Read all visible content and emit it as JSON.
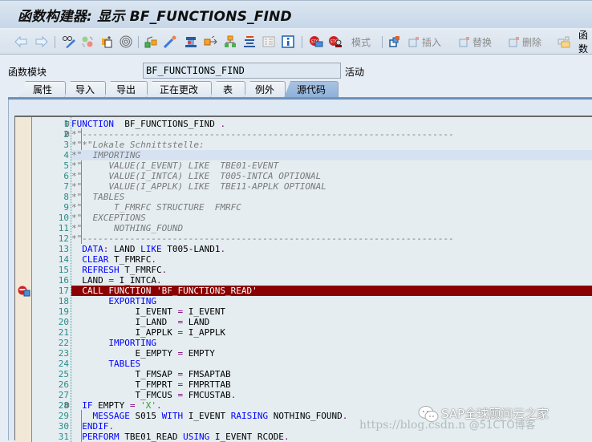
{
  "window": {
    "title": "函数构建器: 显示 BF_FUNCTIONS_FIND"
  },
  "toolbar": {
    "icons": [
      "back-arrow-icon",
      "forward-arrow-icon",
      "display-change-icon",
      "active-inactive-icon",
      "other-object-icon",
      "where-used-icon",
      "check-icon",
      "activate-icon",
      "test-icon",
      "pattern-icon",
      "object-list-icon",
      "pretty-printer-icon",
      "display-object-list-icon",
      "info-icon",
      "breakpoint-session-icon",
      "breakpoint-external-icon",
      "mode-icon",
      "insert-icon",
      "replace-icon",
      "delete-icon",
      "function-doc-icon"
    ],
    "mode_label": "模式",
    "insert_label": "插入",
    "replace_label": "替换",
    "delete_label": "删除",
    "function_doc_label": "函数"
  },
  "header": {
    "field_label": "函数模块",
    "field_value": "BF_FUNCTIONS_FIND",
    "status": "活动"
  },
  "tabs": [
    {
      "label": "属性",
      "active": false
    },
    {
      "label": "导入",
      "active": false
    },
    {
      "label": "导出",
      "active": false
    },
    {
      "label": "正在更改",
      "active": false
    },
    {
      "label": "表",
      "active": false
    },
    {
      "label": "例外",
      "active": false
    },
    {
      "label": "源代码",
      "active": true
    }
  ],
  "editor": {
    "breakpoint_line": 17,
    "cursor_line": 4,
    "lines": [
      {
        "n": "1",
        "fold": "⊟",
        "tokens": [
          [
            "kw",
            "FUNCTION"
          ],
          [
            "",
            "  BF_FUNCTIONS_FIND "
          ],
          [
            "op",
            "."
          ]
        ]
      },
      {
        "n": "2",
        "fold": "⊟",
        "tokens": [
          [
            "cm",
            "*\"----------------------------------------------------------------------"
          ]
        ]
      },
      {
        "n": "3",
        "fold": "",
        "tokens": [
          [
            "cm",
            "*\"*\"Lokale Schnittstelle:"
          ]
        ]
      },
      {
        "n": "4",
        "fold": "",
        "tokens": [
          [
            "cm",
            "*\"  IMPORTING"
          ]
        ]
      },
      {
        "n": "5",
        "fold": "",
        "tokens": [
          [
            "cm",
            "*\"     VALUE(I_EVENT) LIKE  TBE01-EVENT"
          ]
        ]
      },
      {
        "n": "6",
        "fold": "",
        "tokens": [
          [
            "cm",
            "*\"     VALUE(I_INTCA) LIKE  T005-INTCA OPTIONAL"
          ]
        ]
      },
      {
        "n": "7",
        "fold": "",
        "tokens": [
          [
            "cm",
            "*\"     VALUE(I_APPLK) LIKE  TBE11-APPLK OPTIONAL"
          ]
        ]
      },
      {
        "n": "8",
        "fold": "",
        "tokens": [
          [
            "cm",
            "*\"  TABLES"
          ]
        ]
      },
      {
        "n": "9",
        "fold": "",
        "tokens": [
          [
            "cm",
            "*\"      T_FMRFC STRUCTURE  FMRFC"
          ]
        ]
      },
      {
        "n": "10",
        "fold": "",
        "tokens": [
          [
            "cm",
            "*\"  EXCEPTIONS"
          ]
        ]
      },
      {
        "n": "11",
        "fold": "",
        "tokens": [
          [
            "cm",
            "*\"      NOTHING_FOUND"
          ]
        ]
      },
      {
        "n": "12",
        "fold": "",
        "tokens": [
          [
            "cm",
            "*\"----------------------------------------------------------------------"
          ]
        ]
      },
      {
        "n": "13",
        "fold": "",
        "tokens": [
          [
            "",
            "  "
          ],
          [
            "kw",
            "DATA"
          ],
          [
            "op",
            ":"
          ],
          [
            "",
            " LAND "
          ],
          [
            "kw",
            "LIKE"
          ],
          [
            "",
            " T005-LAND1"
          ],
          [
            "op",
            "."
          ]
        ]
      },
      {
        "n": "14",
        "fold": "",
        "tokens": [
          [
            "",
            "  "
          ],
          [
            "kw",
            "CLEAR"
          ],
          [
            "",
            " T_FMRFC"
          ],
          [
            "op",
            "."
          ]
        ]
      },
      {
        "n": "15",
        "fold": "",
        "tokens": [
          [
            "",
            "  "
          ],
          [
            "kw",
            "REFRESH"
          ],
          [
            "",
            " T_FMRFC"
          ],
          [
            "op",
            "."
          ]
        ]
      },
      {
        "n": "16",
        "fold": "",
        "tokens": [
          [
            "",
            "  LAND "
          ],
          [
            "op",
            "="
          ],
          [
            "",
            " I_INTCA"
          ],
          [
            "op",
            "."
          ]
        ]
      },
      {
        "n": "17",
        "fold": "",
        "tokens": [
          [
            "",
            "  CALL FUNCTION 'BF_FUNCTIONS_READ'"
          ]
        ]
      },
      {
        "n": "18",
        "fold": "",
        "tokens": [
          [
            "",
            "       "
          ],
          [
            "kw",
            "EXPORTING"
          ]
        ]
      },
      {
        "n": "19",
        "fold": "",
        "tokens": [
          [
            "",
            "            I_EVENT "
          ],
          [
            "op",
            "="
          ],
          [
            "",
            " I_EVENT"
          ]
        ]
      },
      {
        "n": "20",
        "fold": "",
        "tokens": [
          [
            "",
            "            I_LAND  "
          ],
          [
            "op",
            "="
          ],
          [
            "",
            " LAND"
          ]
        ]
      },
      {
        "n": "21",
        "fold": "",
        "tokens": [
          [
            "",
            "            I_APPLK "
          ],
          [
            "op",
            "="
          ],
          [
            "",
            " I_APPLK"
          ]
        ]
      },
      {
        "n": "22",
        "fold": "",
        "tokens": [
          [
            "",
            "       "
          ],
          [
            "kw",
            "IMPORTING"
          ]
        ]
      },
      {
        "n": "23",
        "fold": "",
        "tokens": [
          [
            "",
            "            E_EMPTY "
          ],
          [
            "op",
            "="
          ],
          [
            "",
            " EMPTY"
          ]
        ]
      },
      {
        "n": "24",
        "fold": "",
        "tokens": [
          [
            "",
            "       "
          ],
          [
            "kw",
            "TABLES"
          ]
        ]
      },
      {
        "n": "25",
        "fold": "",
        "tokens": [
          [
            "",
            "            T_FMSAP "
          ],
          [
            "op",
            "="
          ],
          [
            "",
            " FMSAPTAB"
          ]
        ]
      },
      {
        "n": "26",
        "fold": "",
        "tokens": [
          [
            "",
            "            T_FMPRT "
          ],
          [
            "op",
            "="
          ],
          [
            "",
            " FMPRTTAB"
          ]
        ]
      },
      {
        "n": "27",
        "fold": "",
        "tokens": [
          [
            "",
            "            T_FMCUS "
          ],
          [
            "op",
            "="
          ],
          [
            "",
            " FMCUSTAB"
          ],
          [
            "op",
            "."
          ]
        ]
      },
      {
        "n": "28",
        "fold": "⊟",
        "tokens": [
          [
            "",
            "  "
          ],
          [
            "kw",
            "IF"
          ],
          [
            "",
            " EMPTY "
          ],
          [
            "op",
            "="
          ],
          [
            "",
            " "
          ],
          [
            "str",
            "'X'"
          ],
          [
            "op",
            "."
          ]
        ]
      },
      {
        "n": "29",
        "fold": "",
        "tokens": [
          [
            "",
            "    "
          ],
          [
            "kw",
            "MESSAGE"
          ],
          [
            "",
            " S015 "
          ],
          [
            "kw",
            "WITH"
          ],
          [
            "",
            " I_EVENT "
          ],
          [
            "kw",
            "RAISING"
          ],
          [
            "",
            " NOTHING_FOUND"
          ],
          [
            "op",
            "."
          ]
        ]
      },
      {
        "n": "30",
        "fold": "",
        "tokens": [
          [
            "",
            "  "
          ],
          [
            "kw",
            "ENDIF"
          ],
          [
            "op",
            "."
          ]
        ]
      },
      {
        "n": "31",
        "fold": "",
        "tokens": [
          [
            "",
            "  "
          ],
          [
            "kw",
            "PERFORM"
          ],
          [
            "",
            " TBE01_READ "
          ],
          [
            "kw",
            "USING"
          ],
          [
            "",
            " I_EVENT RCODE"
          ],
          [
            "op",
            "."
          ]
        ]
      }
    ]
  },
  "watermark": {
    "brand": "SAP全球顾问云之家",
    "url": "https://blog.csdn.n",
    "blog": "@51CTO博客"
  }
}
